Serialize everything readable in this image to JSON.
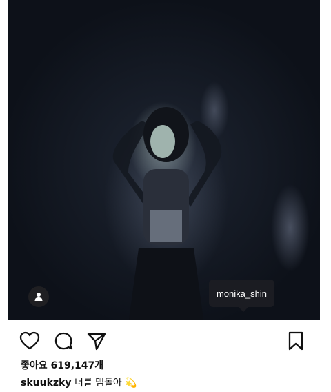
{
  "post": {
    "tagged_user": "monika_shin",
    "likes_label": "좋아요",
    "likes_count": "619,147개",
    "caption_user": "skuukzky",
    "caption_text": "너를 맴돌아",
    "caption_emoji": "💫"
  },
  "icons": {
    "user_tags": "person-icon",
    "like": "heart-icon",
    "comment": "comment-icon",
    "share": "send-icon",
    "save": "bookmark-icon"
  }
}
